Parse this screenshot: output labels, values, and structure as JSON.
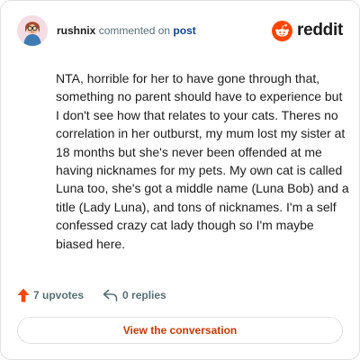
{
  "comment": {
    "username": "rushnix",
    "action_text": "commented on",
    "post_link_label": "post",
    "body": "NTA, horrible for her to have gone through that, something no parent should have to experience but I don't see how that relates to your cats. Theres no correlation in her outburst, my mum lost my sister at 18 months but she's never been offended at me having nicknames for my pets. My own cat is called Luna too, she's got a middle name (Luna Bob) and a title (Lady Luna), and tons of nicknames. I'm a self confessed crazy cat lady though so I'm maybe biased here."
  },
  "brand": {
    "wordmark": "reddit",
    "icon": "reddit-snoo-icon",
    "color": "#ff4500"
  },
  "stats": {
    "upvotes_label": "7 upvotes",
    "upvote_icon": "upvote-arrow-icon",
    "upvote_color": "#ff4500",
    "replies_label": "0 replies",
    "reply_icon": "reply-arrow-icon"
  },
  "cta": {
    "label": "View the conversation",
    "color": "#cc3700"
  }
}
